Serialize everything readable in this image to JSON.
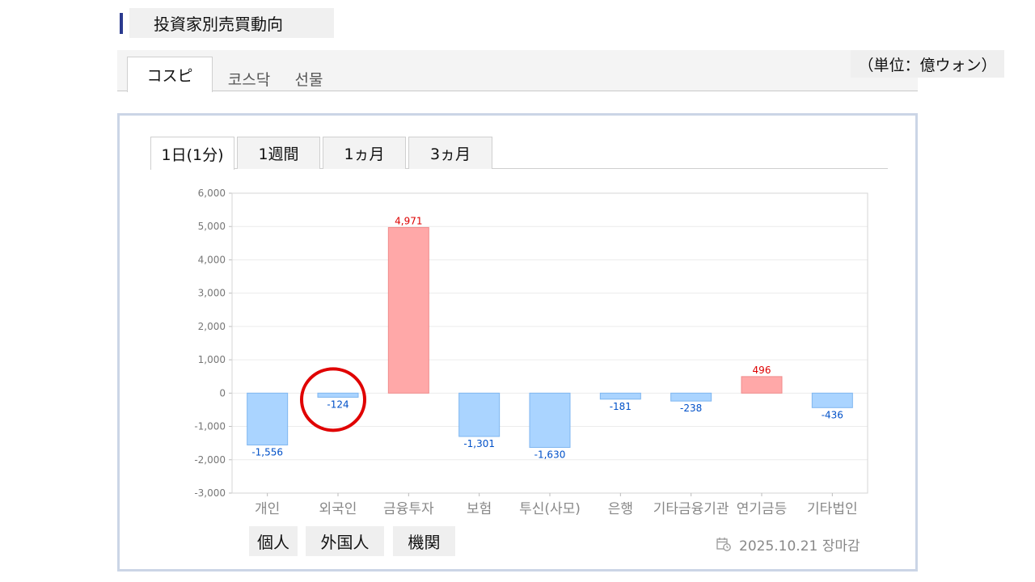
{
  "page_title": "投資家別売買動向",
  "market_tabs": [
    {
      "label": "コスピ",
      "active": true
    },
    {
      "label": "코스닥",
      "active": false
    },
    {
      "label": "선물",
      "active": false
    }
  ],
  "unit_label": "（単位：億ウォン）",
  "period_tabs": [
    {
      "label": "1日(1分)",
      "active": true
    },
    {
      "label": "1週間",
      "active": false
    },
    {
      "label": "1ヵ月",
      "active": false
    },
    {
      "label": "3ヵ月",
      "active": false
    }
  ],
  "group_labels": [
    "個人",
    "外国人",
    "機関"
  ],
  "date_text": "2025.10.21 장마감",
  "colors": {
    "positive": "#ffa8a8",
    "negative": "#aad4ff",
    "positive_label": "#dd0000",
    "negative_label": "#0050c8",
    "highlight_circle": "#e00000"
  },
  "chart_data": {
    "type": "bar",
    "categories": [
      "개인",
      "외국인",
      "금융투자",
      "보험",
      "투신(사모)",
      "은행",
      "기타금융",
      "기관",
      "연기금등",
      "기타법인"
    ],
    "category_labels_wide": [
      "개인",
      "외국인",
      "금융투자",
      "보험",
      "투신(사모)",
      "은행",
      "기타금융기관",
      "연기금등",
      "기타법인"
    ],
    "values": [
      -1556,
      -124,
      4971,
      -1301,
      -1630,
      -181,
      -238,
      496,
      -436
    ],
    "value_labels": [
      "-1,556",
      "-124",
      "4,971",
      "-1,301",
      "-1,630",
      "-181",
      "-238",
      "496",
      "-436"
    ],
    "ylim": [
      -3000,
      6000
    ],
    "yticks": [
      "6,000",
      "5,000",
      "4,000",
      "3,000",
      "2,000",
      "1,000",
      "0",
      "-1,000",
      "-2,000",
      "-3,000"
    ],
    "ytick_values": [
      6000,
      5000,
      4000,
      3000,
      2000,
      1000,
      0,
      -1000,
      -2000,
      -3000
    ],
    "highlighted_category": "외국인",
    "grid": true
  }
}
